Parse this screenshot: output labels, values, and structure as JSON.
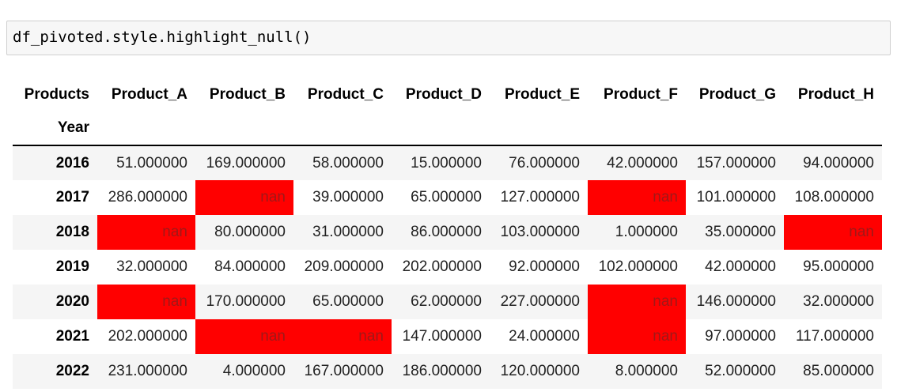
{
  "code_cell": {
    "source": "df_pivoted.style.highlight_null()"
  },
  "table": {
    "columns_name": "Products",
    "index_name": "Year",
    "columns": [
      "Product_A",
      "Product_B",
      "Product_C",
      "Product_D",
      "Product_E",
      "Product_F",
      "Product_G",
      "Product_H"
    ],
    "null_color": "#ff0000",
    "rows": [
      {
        "index": "2016",
        "cells": [
          "51.000000",
          "169.000000",
          "58.000000",
          "15.000000",
          "76.000000",
          "42.000000",
          "157.000000",
          "94.000000"
        ]
      },
      {
        "index": "2017",
        "cells": [
          "286.000000",
          "nan",
          "39.000000",
          "65.000000",
          "127.000000",
          "nan",
          "101.000000",
          "108.000000"
        ]
      },
      {
        "index": "2018",
        "cells": [
          "nan",
          "80.000000",
          "31.000000",
          "86.000000",
          "103.000000",
          "1.000000",
          "35.000000",
          "nan"
        ]
      },
      {
        "index": "2019",
        "cells": [
          "32.000000",
          "84.000000",
          "209.000000",
          "202.000000",
          "92.000000",
          "102.000000",
          "42.000000",
          "95.000000"
        ]
      },
      {
        "index": "2020",
        "cells": [
          "nan",
          "170.000000",
          "65.000000",
          "62.000000",
          "227.000000",
          "nan",
          "146.000000",
          "32.000000"
        ]
      },
      {
        "index": "2021",
        "cells": [
          "202.000000",
          "nan",
          "nan",
          "147.000000",
          "24.000000",
          "nan",
          "97.000000",
          "117.000000"
        ]
      },
      {
        "index": "2022",
        "cells": [
          "231.000000",
          "4.000000",
          "167.000000",
          "186.000000",
          "120.000000",
          "8.000000",
          "52.000000",
          "85.000000"
        ]
      }
    ]
  }
}
